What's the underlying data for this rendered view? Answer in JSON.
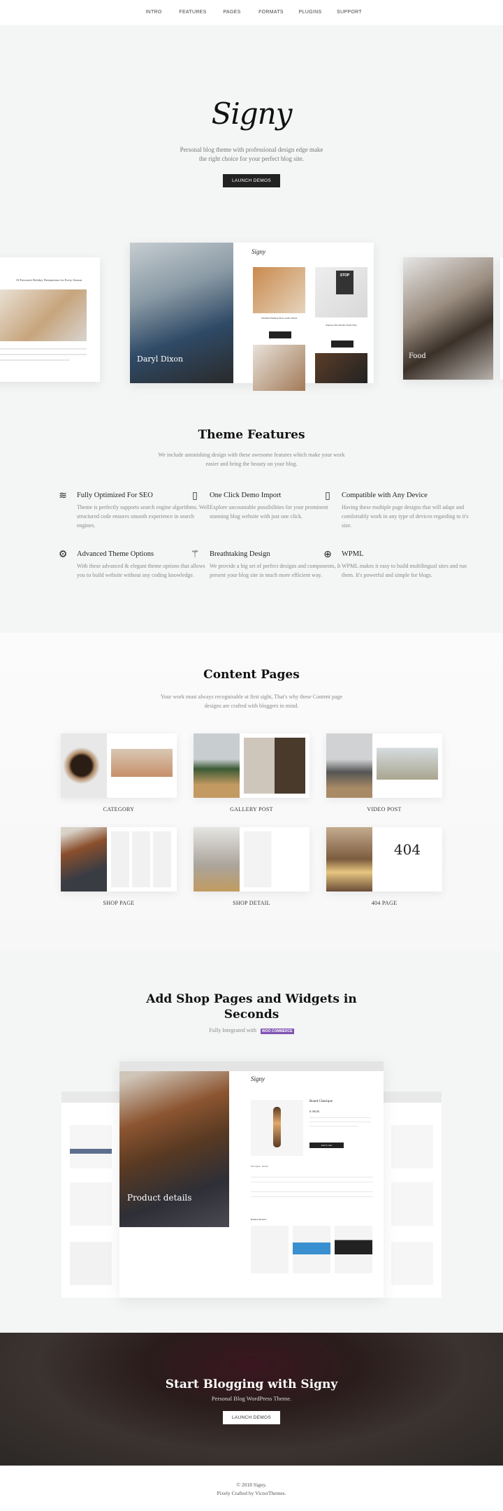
{
  "nav": {
    "items": [
      "INTRO",
      "FEATURES",
      "PAGES",
      "FORMATS",
      "PLUGINS",
      "SUPPORT"
    ]
  },
  "hero": {
    "logo": "Signy",
    "subtitle_line1": "Personal blog theme with professional design edge make",
    "subtitle_line2": "the right choice for your perfect blog site.",
    "button": "LAUNCH DEMOS",
    "preview": {
      "left_heading": "10 Favourite Holiday Destinations for Every Season",
      "center_title": "Daryl Dixon",
      "center_logo": "Signy",
      "post1": "The Best Holiday Place in the World",
      "post2": "Explore The Pacific North Way",
      "stop_sign": "STOP",
      "right_title": "Food"
    }
  },
  "features": {
    "title": "Theme Features",
    "subtitle_line1": "We include astonishing design with these awesome features which make your work",
    "subtitle_line2": "easier and bring the beauty on your blog.",
    "items": [
      {
        "icon": "layers-icon",
        "title": "Fully Optimized For SEO",
        "desc": "Theme is perfectly supports search engine algorithms. Well structured code ensures smooth experience in search engines."
      },
      {
        "icon": "mouse-icon",
        "title": "One Click Demo Import",
        "desc": "Explore uncountable possibilities for your prominent stunning blog website with just one click."
      },
      {
        "icon": "mobile-icon",
        "title": "Compatible with Any Device",
        "desc": "Having these multiple page designs that will adapt and comfortably work in any type of devices regarding to it's size."
      },
      {
        "icon": "gear-icon",
        "title": "Advanced Theme Options",
        "desc": "With these advanced & elegant theme options that allows you to build website without any coding knowledge."
      },
      {
        "icon": "magic-wand-icon",
        "title": "Breathtaking Design",
        "desc": "We provide a big set of perfect designs and components, It present your blog site in much more efficient way."
      },
      {
        "icon": "globe-icon",
        "title": "WPML",
        "desc": "WPML makes it easy to build multilingual sites and run them. It's powerful and simple for blogs."
      }
    ]
  },
  "content_pages": {
    "title": "Content Pages",
    "subtitle_line1": "Your work must always recognisable at first sight, That's why these Content page",
    "subtitle_line2": "designs are crafted with bloggers in mind.",
    "items": [
      {
        "label": "CATEGORY",
        "colors": [
          "#6b5d50",
          "#d9cfc2"
        ]
      },
      {
        "label": "GALLERY POST",
        "colors": [
          "#c9a97a",
          "#5a4a3a"
        ]
      },
      {
        "label": "VIDEO POST",
        "colors": [
          "#8a8680",
          "#d7d8d2"
        ]
      },
      {
        "label": "SHOP PAGE",
        "colors": [
          "#6a4a33",
          "#f2f2f2"
        ]
      },
      {
        "label": "SHOP DETAIL",
        "colors": [
          "#b8b4ac",
          "#f5f5f5"
        ]
      },
      {
        "label": "404 PAGE",
        "colors": [
          "#8e6b4a",
          "#ffffff"
        ]
      }
    ],
    "error_code": "404"
  },
  "shop": {
    "title_line1": "Add Shop Pages and Widgets in",
    "title_line2": "Seconds",
    "integrated_text": "Fully Integrated with",
    "woo_logo": "WOO COMMERCE",
    "woo_color": "#7f54b3",
    "mockup": {
      "logo": "Signy",
      "hero_title": "Product details",
      "product_name": "Board Classique",
      "price": "$ 190.00",
      "add_to_cart": "Add To Cart",
      "tabs": [
        "Description",
        "Review"
      ],
      "related_title": "Related Product"
    }
  },
  "cta": {
    "title": "Start Blogging with Signy",
    "subtitle": "Personal Blog WordPress Theme.",
    "button": "LAUNCH DEMOS"
  },
  "footer": {
    "copyright": "© 2018 Signy.",
    "credit": "Pixely Crafted by VictorThemes."
  }
}
